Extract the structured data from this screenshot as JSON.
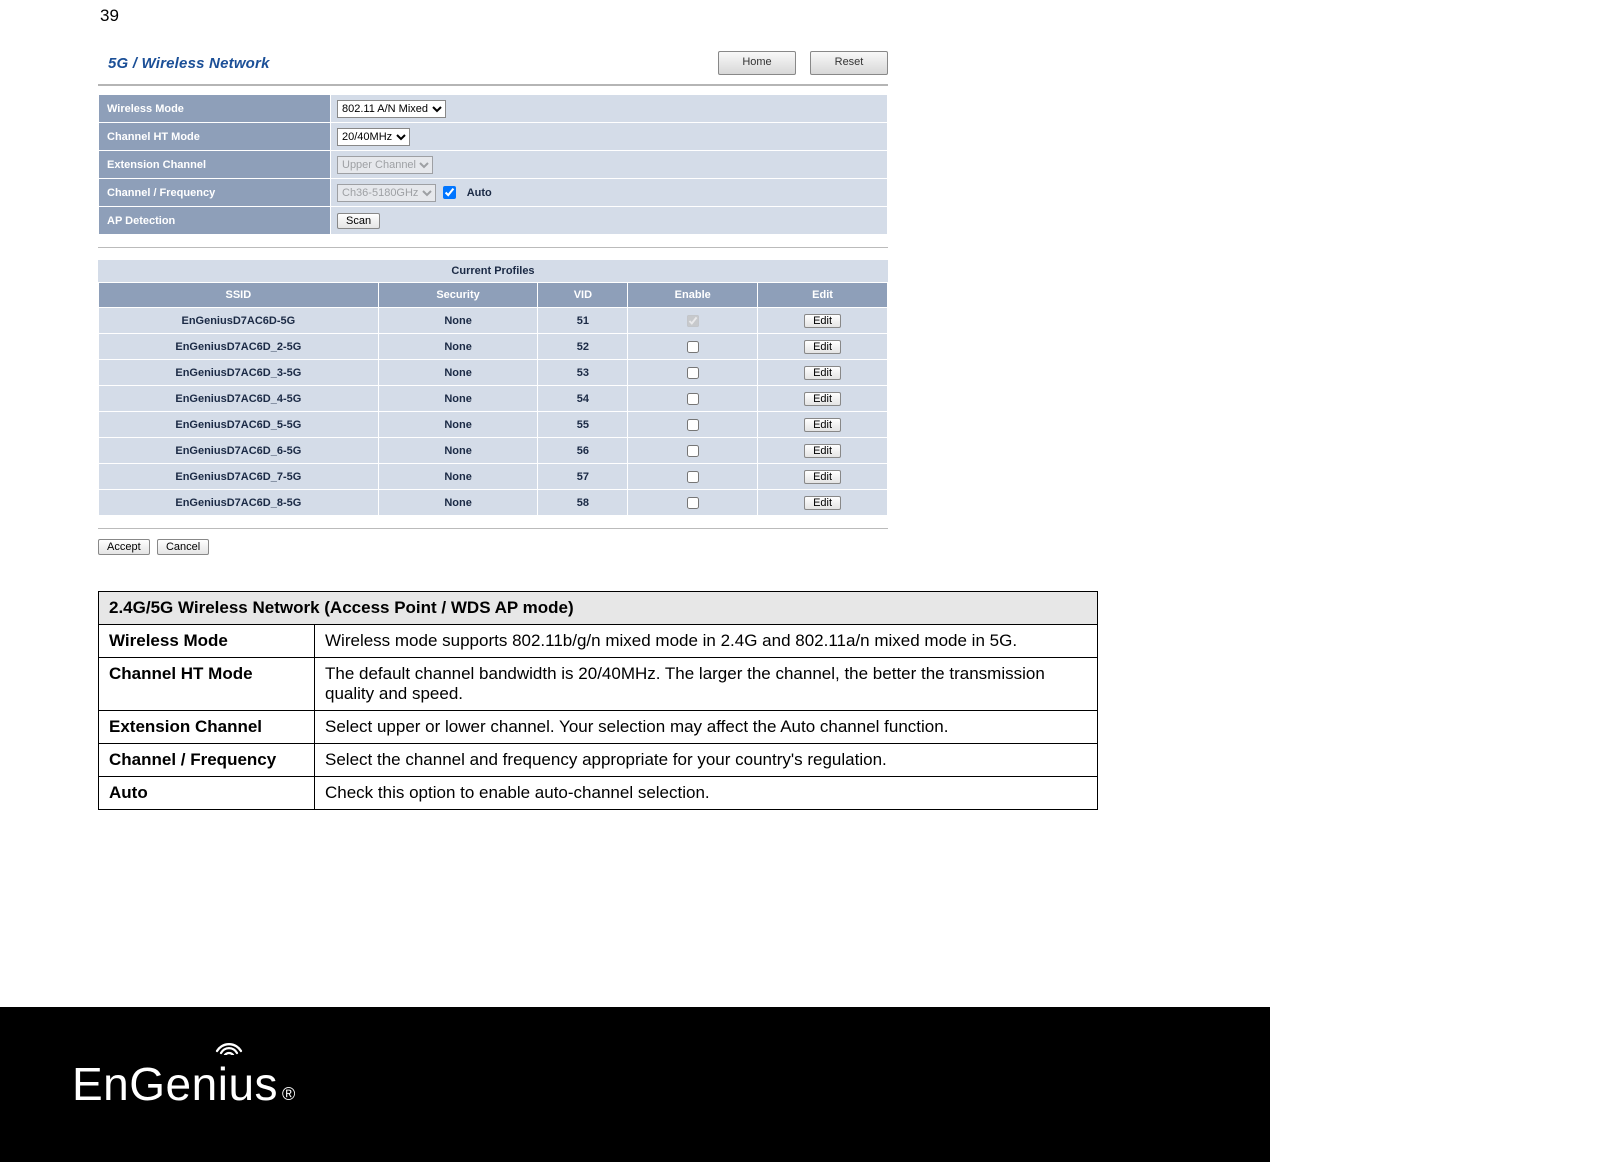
{
  "page_number": "39",
  "router": {
    "title": "5G / Wireless Network",
    "buttons": {
      "home": "Home",
      "reset": "Reset"
    },
    "settings": {
      "wireless_mode": {
        "label": "Wireless Mode",
        "value": "802.11 A/N Mixed"
      },
      "channel_ht": {
        "label": "Channel HT Mode",
        "value": "20/40MHz"
      },
      "ext_channel": {
        "label": "Extension Channel",
        "value": "Upper Channel"
      },
      "channel_freq": {
        "label": "Channel / Frequency",
        "value": "Ch36-5180GHz",
        "auto_label": "Auto",
        "auto_checked": true
      },
      "ap_detection": {
        "label": "AP Detection",
        "button": "Scan"
      }
    },
    "profiles": {
      "caption": "Current Profiles",
      "headers": {
        "ssid": "SSID",
        "security": "Security",
        "vid": "VID",
        "enable": "Enable",
        "edit": "Edit"
      },
      "edit_label": "Edit",
      "rows": [
        {
          "ssid": "EnGeniusD7AC6D-5G",
          "security": "None",
          "vid": "51",
          "enabled": true
        },
        {
          "ssid": "EnGeniusD7AC6D_2-5G",
          "security": "None",
          "vid": "52",
          "enabled": false
        },
        {
          "ssid": "EnGeniusD7AC6D_3-5G",
          "security": "None",
          "vid": "53",
          "enabled": false
        },
        {
          "ssid": "EnGeniusD7AC6D_4-5G",
          "security": "None",
          "vid": "54",
          "enabled": false
        },
        {
          "ssid": "EnGeniusD7AC6D_5-5G",
          "security": "None",
          "vid": "55",
          "enabled": false
        },
        {
          "ssid": "EnGeniusD7AC6D_6-5G",
          "security": "None",
          "vid": "56",
          "enabled": false
        },
        {
          "ssid": "EnGeniusD7AC6D_7-5G",
          "security": "None",
          "vid": "57",
          "enabled": false
        },
        {
          "ssid": "EnGeniusD7AC6D_8-5G",
          "security": "None",
          "vid": "58",
          "enabled": false
        }
      ]
    },
    "actions": {
      "accept": "Accept",
      "cancel": "Cancel"
    }
  },
  "desc": {
    "header": "2.4G/5G Wireless Network (Access Point / WDS AP mode)",
    "rows": [
      {
        "k": "Wireless Mode",
        "v": "Wireless mode supports 802.11b/g/n mixed mode in 2.4G and 802.11a/n mixed mode in 5G."
      },
      {
        "k": "Channel HT Mode",
        "v": "The default channel bandwidth is 20/40MHz. The larger the channel, the better the transmission quality and speed."
      },
      {
        "k": "Extension Channel",
        "v": "Select upper or lower channel. Your selection may affect the Auto channel function."
      },
      {
        "k": "Channel / Frequency",
        "v": "Select the channel and frequency appropriate for your country's regulation."
      },
      {
        "k": "Auto",
        "v": "Check this option to enable auto-channel selection."
      }
    ]
  },
  "brand": {
    "name_a": "EnGen",
    "name_b": "us",
    "reg": "®"
  }
}
